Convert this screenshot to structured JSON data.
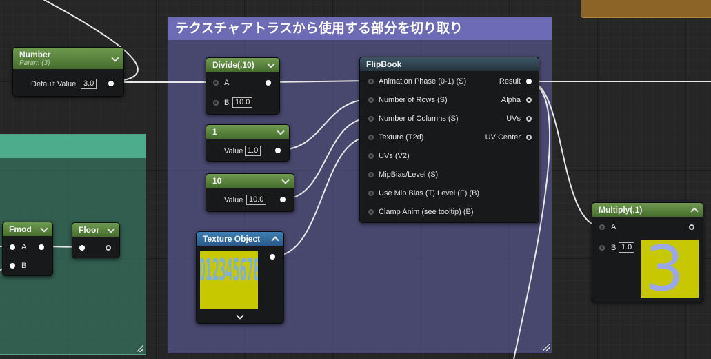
{
  "comments": {
    "purple_title": "テクスチャアトラスから使用する部分を切り取り"
  },
  "nodes": {
    "number": {
      "title": "Number",
      "subtitle": "Param (3)",
      "label": "Default Value",
      "value": "3.0"
    },
    "divide": {
      "title": "Divide(,10)",
      "pin_a": "A",
      "pin_b": "B",
      "b_value": "10.0"
    },
    "const1": {
      "title": "1",
      "label": "Value",
      "value": "1.0"
    },
    "const10": {
      "title": "10",
      "label": "Value",
      "value": "10.0"
    },
    "texture_object": {
      "title": "Texture Object",
      "preview_text": "0123456789"
    },
    "flipbook": {
      "title": "FlipBook",
      "inputs": [
        "Animation  Phase (0-1) (S)",
        "Number of Rows (S)",
        "Number of Columns (S)",
        "Texture (T2d)",
        "UVs (V2)",
        "MipBias/Level (S)",
        "Use Mip Bias (T) Level (F) (B)",
        "Clamp Anim (see tooltip) (B)"
      ],
      "outputs": [
        "Result",
        "Alpha",
        "UVs",
        "UV Center"
      ]
    },
    "multiply": {
      "title": "Multiply(,1)",
      "pin_a": "A",
      "pin_b": "B",
      "b_value": "1.0",
      "preview_text": "3"
    },
    "fmod": {
      "title": "Fmod",
      "pin_a": "A",
      "pin_b": "B"
    },
    "floor": {
      "title": "Floor"
    }
  },
  "colors": {
    "background": "#262626",
    "comment_purple": "#6d6ab6",
    "comment_green": "#4cac8c",
    "node_header_green": "#466d2e",
    "node_header_blue": "#2a5a86",
    "texture_yellow": "#c8c800"
  }
}
